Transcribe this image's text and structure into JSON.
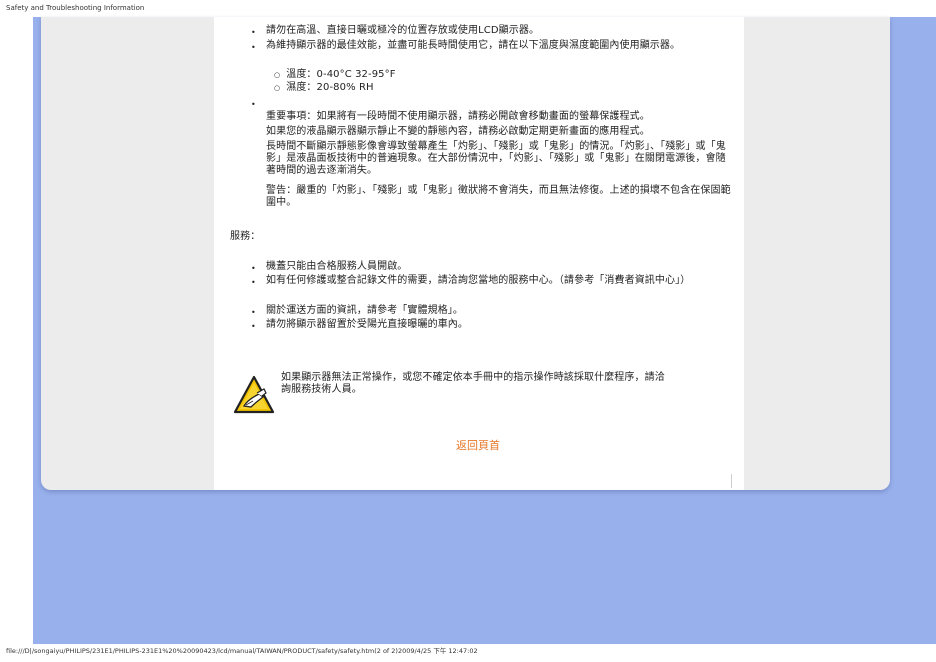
{
  "page_header": "Safety and Troubleshooting Information",
  "page_footer": "file:///D|/songaiyu/PHILIPS/231E1/PHILIPS-231E1%20%20090423/lcd/manual/TAIWAN/PRODUCT/safety/safety.htm(2 of 2)2009/4/25 下午 12:47:02",
  "bullets_top": [
    "請勿在高溫、直接日曬或極冷的位置存放或使用LCD顯示器。",
    "為維持顯示器的最佳效能，並盡可能長時間使用它，請在以下溫度與濕度範圍內使用顯示器。"
  ],
  "conditions": [
    "溫度：0-40°C 32-95°F",
    "濕度：20-80% RH"
  ],
  "important_note": [
    "重要事項：如果將有一段時間不使用顯示器，請務必開啟會移動畫面的螢幕保護程式。",
    "如果您的液晶顯示器顯示靜止不變的靜態內容，請務必啟動定期更新畫面的應用程式。",
    "長時間不斷顯示靜態影像會導致螢幕產生「灼影」、「殘影」或「鬼影」的情況。「灼影」、「殘影」或「鬼影」是液晶面板技術中的普遍現象。在大部份情況中，「灼影」、「殘影」或「鬼影」在關閉電源後，會隨著時間的過去逐漸消失。",
    "警告：嚴重的「灼影」、「殘影」或「鬼影」徵狀將不會消失，而且無法修復。上述的損壞不包含在保固範圍中。"
  ],
  "services": {
    "label": "服務：",
    "items": [
      "機蓋只能由合格服務人員開啟。",
      "如有任何修護或整合記錄文件的需要，請洽詢您當地的服務中心。（請參考「消費者資訊中心」）",
      "關於運送方面的資訊，請參考「實體規格」。",
      "請勿將顯示器留置於受陽光直接曝曬的車內。"
    ]
  },
  "warning_text": "如果顯示器無法正常操作，或您不確定依本手冊中的指示操作時該採取什麼程序，請洽詢服務技術人員。",
  "back_to_top": "返回頁首",
  "colors": {
    "outer_background": "#98b0ec",
    "card_background": "#ececec",
    "link": "#e6782a"
  },
  "icons": {
    "warning": "warning-triangle-hand-icon"
  }
}
